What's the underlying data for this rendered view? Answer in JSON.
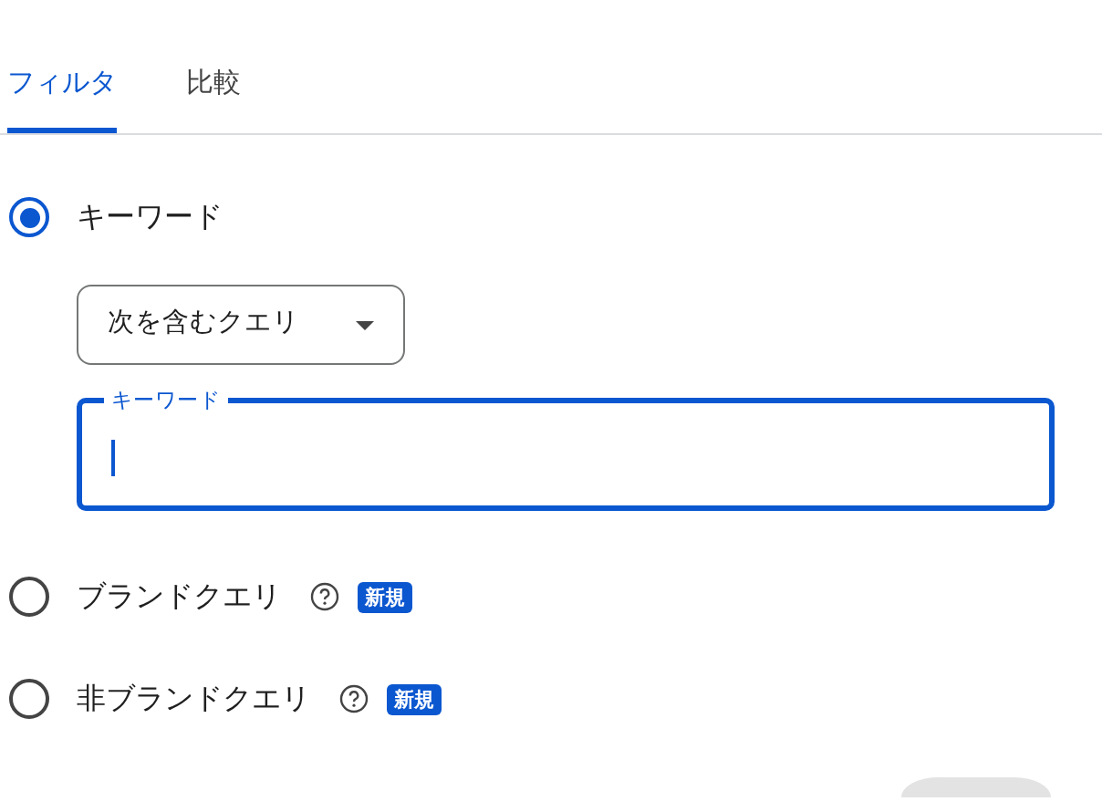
{
  "tabs": [
    {
      "label": "フィルタ",
      "selected": true
    },
    {
      "label": "比較",
      "selected": false
    }
  ],
  "options": [
    {
      "kind": "keyword",
      "label": "キーワード",
      "selected": true,
      "match_dropdown": {
        "value": "次を含むクエリ"
      },
      "keyword_field": {
        "label": "キーワード",
        "focused": true
      }
    },
    {
      "kind": "plain",
      "label": "ブランドクエリ",
      "selected": false,
      "help": true,
      "badge": "新規"
    },
    {
      "kind": "plain",
      "label": "非ブランドクエリ",
      "selected": false,
      "help": true,
      "badge": "新規"
    }
  ],
  "footer_button": {
    "disabled": true
  }
}
